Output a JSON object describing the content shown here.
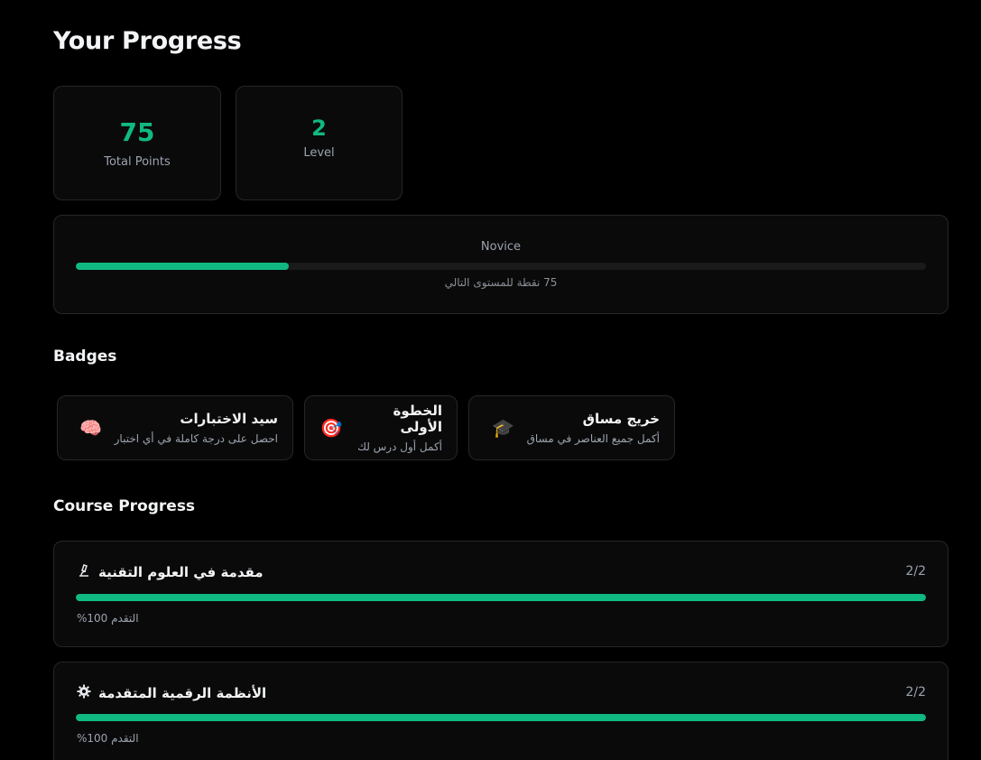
{
  "page": {
    "title": "Your Progress"
  },
  "stats": {
    "points": {
      "value": "75",
      "label": "Total Points"
    },
    "level": {
      "value": "2",
      "label": "Level"
    }
  },
  "level_progress": {
    "name": "Novice",
    "fraction": 0.25,
    "next_text": "75 نقطة للمستوى التالي"
  },
  "badges": {
    "title": "Badges",
    "items": [
      {
        "name": "سيد الاختبارات",
        "desc": "احصل على درجة كاملة في أي اختبار",
        "icon": "brain-icon",
        "glyph": "🧠"
      },
      {
        "name": "الخطوة الأولى",
        "desc": "أكمل أول درس لك",
        "icon": "target-icon",
        "glyph": "🎯"
      },
      {
        "name": "خريج مساق",
        "desc": "أكمل جميع العناصر في مساق",
        "icon": "graduation-cap-icon",
        "glyph": "🎓"
      }
    ]
  },
  "courses": {
    "title": "Course Progress",
    "items": [
      {
        "title": "مقدمة في العلوم التقنية",
        "icon": "microscope-icon",
        "count": "2/2",
        "fraction": 1.0,
        "percent_text": "التقدم 100%"
      },
      {
        "title": "الأنظمة الرقمية المتقدمة",
        "icon": "gear-icon",
        "count": "2/2",
        "fraction": 1.0,
        "percent_text": "التقدم 100%"
      }
    ]
  },
  "colors": {
    "accent": "#10b981",
    "background": "#000000",
    "card": "#0a0a0a",
    "border": "#262626"
  }
}
